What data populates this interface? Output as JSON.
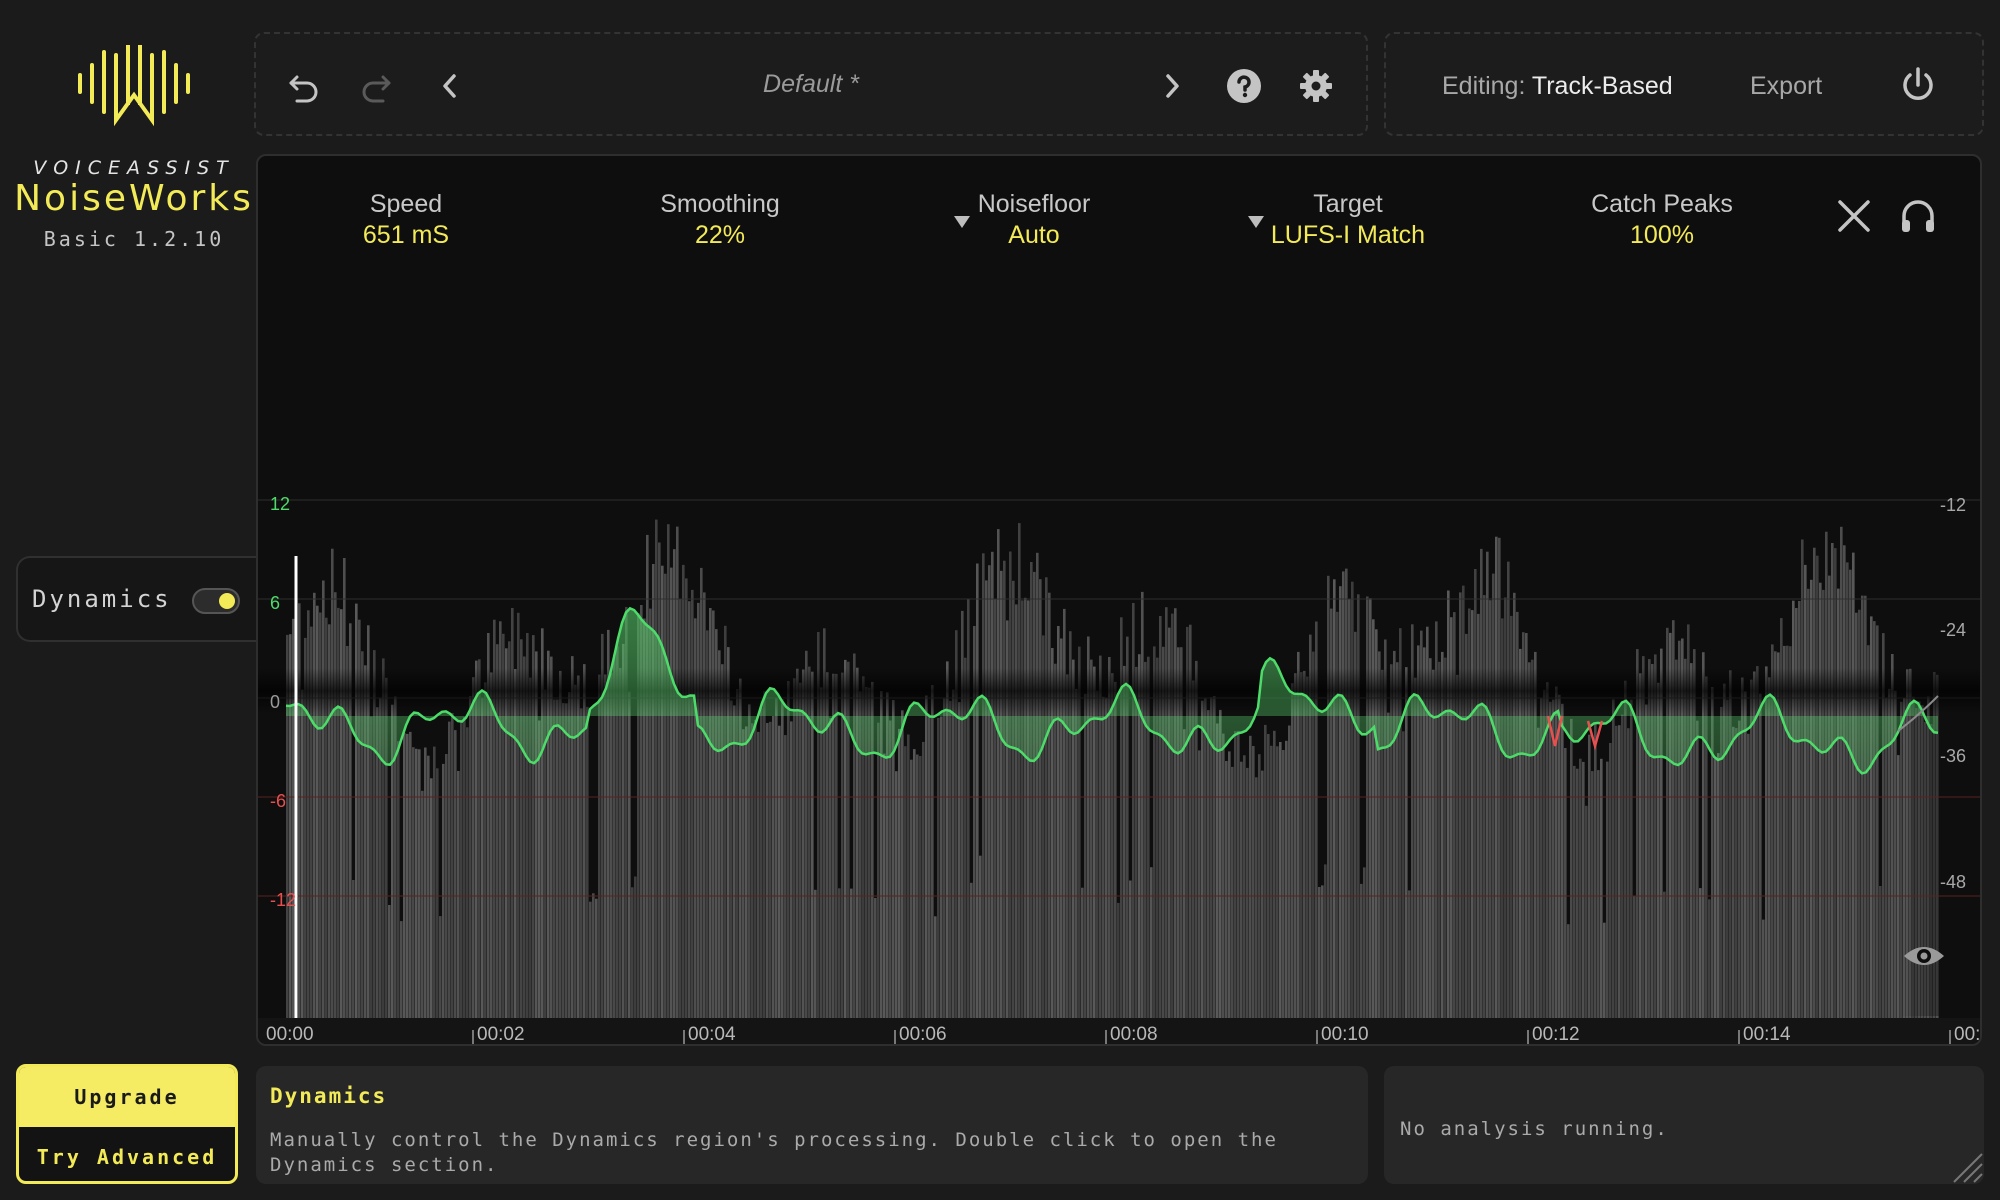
{
  "brand": {
    "company": "VOICEASSIST",
    "product": "NoiseWorks",
    "version": "Basic 1.2.10"
  },
  "toolbar": {
    "preset_name": "Default *",
    "icons": [
      "undo-icon",
      "redo-icon",
      "chevron-left-icon",
      "chevron-right-icon",
      "help-icon",
      "gear-icon"
    ]
  },
  "edit_bar": {
    "editing_label": "Editing:",
    "editing_mode": "Track-Based",
    "export_label": "Export",
    "icons": [
      "power-icon"
    ]
  },
  "parameters": [
    {
      "name": "Speed",
      "value": "651 mS"
    },
    {
      "name": "Smoothing",
      "value": "22%"
    },
    {
      "name": "Noisefloor",
      "value": "Auto"
    },
    {
      "name": "Target",
      "value": "LUFS-I Match"
    },
    {
      "name": "Catch Peaks",
      "value": "100%"
    }
  ],
  "side_tab": {
    "label": "Dynamics",
    "enabled": true
  },
  "plot": {
    "gain_axis": [
      "12",
      "6",
      "0",
      "-6",
      "-12"
    ],
    "level_axis": [
      "-12",
      "-24",
      "-36",
      "-48"
    ],
    "time_axis": [
      "00:00",
      "00:02",
      "00:04",
      "00:06",
      "00:08",
      "00:10",
      "00:12",
      "00:14",
      "00:1"
    ],
    "colors": {
      "gain_positive": "#4ddc6a",
      "gain_negative": "#e85050",
      "accent": "#f3ea58"
    }
  },
  "actions": {
    "upgrade": "Upgrade",
    "try_advanced": "Try Advanced"
  },
  "info": {
    "title": "Dynamics",
    "text": "Manually control the Dynamics region's processing. Double click to open the Dynamics section."
  },
  "status": {
    "text": "No analysis running."
  }
}
